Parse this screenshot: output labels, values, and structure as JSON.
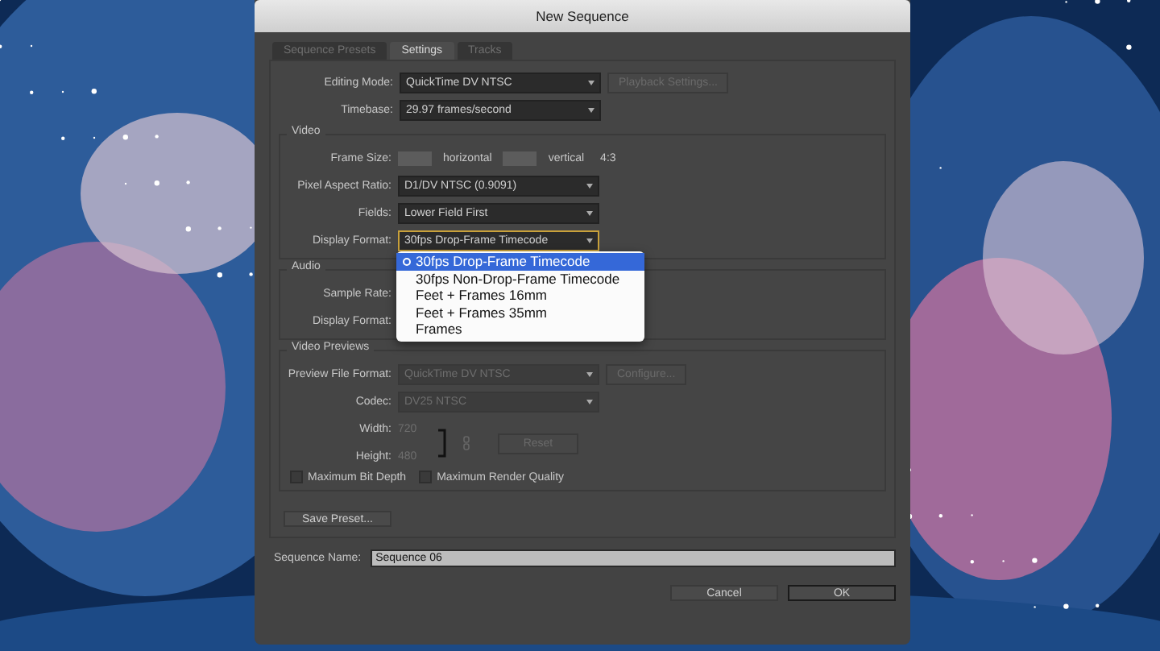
{
  "window": {
    "title": "New Sequence"
  },
  "tabs": [
    {
      "label": "Sequence Presets",
      "selected": false
    },
    {
      "label": "Settings",
      "selected": true
    },
    {
      "label": "Tracks",
      "selected": false
    }
  ],
  "general": [
    {
      "kind": "select",
      "label": "Editing Mode:",
      "value": "QuickTime DV NTSC",
      "disabled": false,
      "open": false,
      "button": {
        "label": "Playback Settings...",
        "disabled": true
      }
    },
    {
      "kind": "select",
      "label": "Timebase:",
      "value": "29.97 frames/second",
      "disabled": false,
      "open": false
    }
  ],
  "video": {
    "title": "Video",
    "rows": [
      {
        "kind": "frame_size",
        "label": "Frame Size:",
        "horizontal_label": "horizontal",
        "vertical_label": "vertical",
        "aspect": "4:3"
      },
      {
        "kind": "select",
        "label": "Pixel Aspect Ratio:",
        "value": "D1/DV NTSC (0.9091)",
        "disabled": false,
        "open": false
      },
      {
        "kind": "select",
        "label": "Fields:",
        "value": "Lower Field First",
        "disabled": false,
        "open": false
      },
      {
        "kind": "select",
        "label": "Display Format:",
        "value": "30fps Drop-Frame Timecode",
        "disabled": false,
        "open": true
      }
    ]
  },
  "display_format_menu": [
    {
      "label": "30fps Drop-Frame Timecode",
      "selected": true
    },
    {
      "label": "30fps Non-Drop-Frame Timecode",
      "selected": false
    },
    {
      "label": "Feet + Frames 16mm",
      "selected": false
    },
    {
      "label": "Feet + Frames 35mm",
      "selected": false
    },
    {
      "label": "Frames",
      "selected": false
    }
  ],
  "audio": {
    "title": "Audio",
    "rows": [
      {
        "label": "Sample Rate:"
      },
      {
        "label": "Display Format:"
      }
    ]
  },
  "video_previews": {
    "title": "Video Previews",
    "rows": [
      {
        "label": "Preview File Format:",
        "value": "QuickTime DV NTSC",
        "disabled": true,
        "button": {
          "label": "Configure...",
          "disabled": true
        }
      },
      {
        "label": "Codec:",
        "value": "DV25 NTSC",
        "disabled": true
      }
    ],
    "width": {
      "label": "Width:",
      "value": "720"
    },
    "height": {
      "label": "Height:",
      "value": "480"
    },
    "reset_button": {
      "label": "Reset",
      "disabled": true
    },
    "checkboxes": [
      {
        "label": "Maximum Bit Depth",
        "checked": false
      },
      {
        "label": "Maximum Render Quality",
        "checked": false
      }
    ]
  },
  "save_preset_button": {
    "label": "Save Preset..."
  },
  "sequence_name": {
    "label": "Sequence Name:",
    "value": "Sequence 06"
  },
  "buttons": [
    {
      "label": "Cancel",
      "default": false
    },
    {
      "label": "OK",
      "default": true
    }
  ]
}
